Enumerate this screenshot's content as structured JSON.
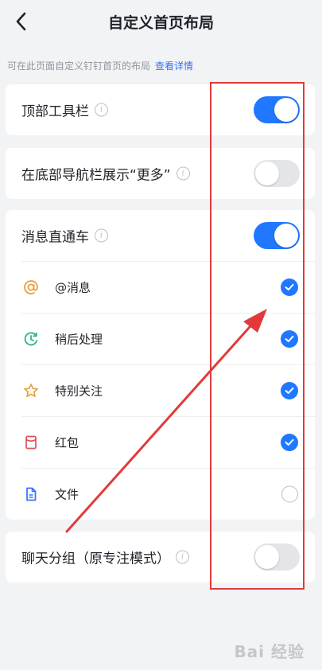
{
  "header": {
    "title": "自定义首页布局"
  },
  "hint": {
    "text": "可在此页面自定义钉钉首页的布局",
    "link": "查看详情"
  },
  "settings": {
    "toolbar": {
      "label": "顶部工具栏",
      "on": true
    },
    "more": {
      "label": "在底部导航栏展示“更多”",
      "on": false
    },
    "message": {
      "label": "消息直通车",
      "on": true,
      "items": [
        {
          "label": "@消息",
          "checked": true,
          "icon": "at-icon",
          "color": "#e8a03c"
        },
        {
          "label": "稍后处理",
          "checked": true,
          "icon": "clock-later-icon",
          "color": "#2db77b"
        },
        {
          "label": "特别关注",
          "checked": true,
          "icon": "star-icon",
          "color": "#e8a03c"
        },
        {
          "label": "红包",
          "checked": true,
          "icon": "red-envelope-icon",
          "color": "#e0505e"
        },
        {
          "label": "文件",
          "checked": false,
          "icon": "file-icon",
          "color": "#3370ff"
        }
      ]
    },
    "chatgroup": {
      "label": "聊天分组（原专注模式）",
      "on": false
    }
  },
  "colors": {
    "accent": "#1f78ff",
    "annotation": "#e23a3a"
  },
  "watermark": {
    "text": "Bai 经验"
  }
}
